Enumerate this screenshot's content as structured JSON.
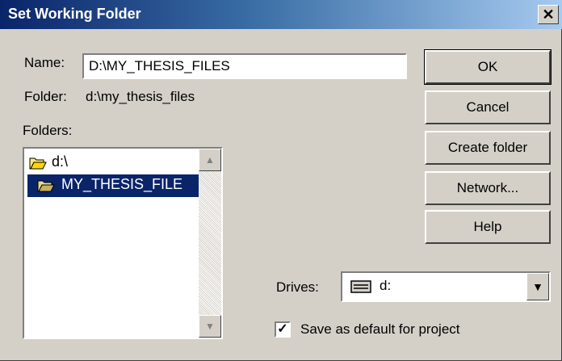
{
  "window": {
    "title": "Set Working Folder",
    "close_glyph": "✕"
  },
  "name_field": {
    "label": "Name:",
    "value": "D:\\MY_THESIS_FILES"
  },
  "folder": {
    "label": "Folder:",
    "value": "d:\\my_thesis_files"
  },
  "folders": {
    "label": "Folders:",
    "items": [
      {
        "label": "d:\\",
        "icon": "folder-open-icon",
        "selected": false
      },
      {
        "label": "MY_THESIS_FILE",
        "icon": "folder-open-icon",
        "selected": true
      }
    ]
  },
  "buttons": {
    "ok": "OK",
    "cancel": "Cancel",
    "create_folder": "Create folder",
    "network": "Network...",
    "help": "Help"
  },
  "drives": {
    "label": "Drives:",
    "value": "d:",
    "icon": "drive-icon"
  },
  "save_default": {
    "label": "Save as default for project",
    "checked": true
  },
  "colors": {
    "title_gradient_start": "#0a246a",
    "title_gradient_end": "#a6caf0",
    "face": "#d4d0c8",
    "selection": "#0a246a"
  }
}
